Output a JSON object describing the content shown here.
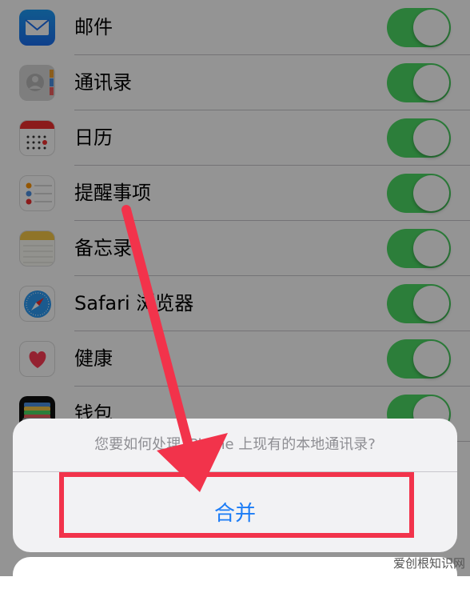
{
  "settings": {
    "rows": [
      {
        "label": "邮件",
        "icon": "mail-icon"
      },
      {
        "label": "通讯录",
        "icon": "contacts-icon"
      },
      {
        "label": "日历",
        "icon": "calendar-icon"
      },
      {
        "label": "提醒事项",
        "icon": "reminders-icon"
      },
      {
        "label": "备忘录",
        "icon": "notes-icon"
      },
      {
        "label": "Safari 浏览器",
        "icon": "safari-icon"
      },
      {
        "label": "健康",
        "icon": "health-icon"
      },
      {
        "label": "钱包",
        "icon": "wallet-icon"
      }
    ],
    "toggle_color": "#4cd964"
  },
  "action_sheet": {
    "message": "您要如何处理 iPhone 上现有的本地通讯录?",
    "merge_label": "合并",
    "action_color": "#1b7cf6"
  },
  "annotation": {
    "highlight_color": "#f2334b"
  },
  "watermark": "爱创根知识网"
}
